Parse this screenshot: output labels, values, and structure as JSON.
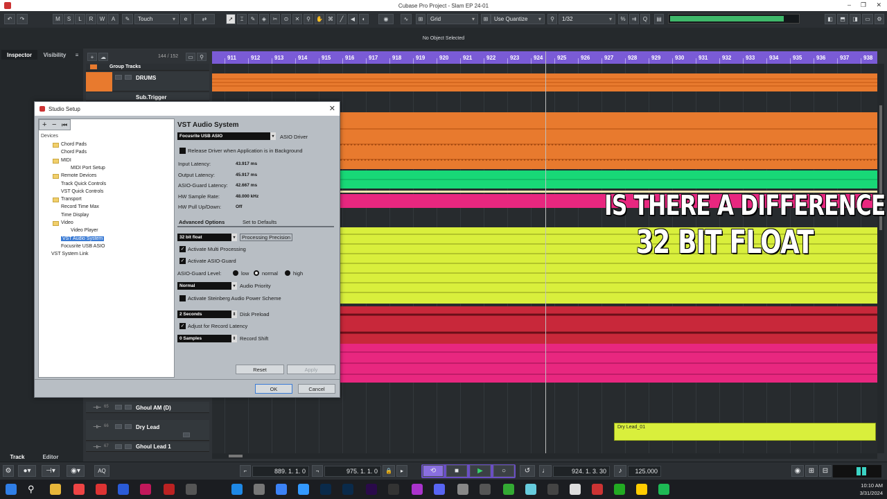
{
  "window": {
    "title": "Cubase Pro Project - Slam EP 24-01"
  },
  "toolbar": {
    "mode_buttons": [
      "M",
      "S",
      "L",
      "R",
      "W",
      "A"
    ],
    "automation_mode": "Touch",
    "snap_type": "Grid",
    "quantize_mode": "Use Quantize",
    "quantize_value": "1/32"
  },
  "info_line": {
    "text": "No Object Selected"
  },
  "left_zone": {
    "tab_inspector": "Inspector",
    "tab_visibility": "Visibility",
    "tab_track": "Track",
    "tab_editor": "Editor"
  },
  "track_list": {
    "count": "144 / 152",
    "group_label": "Group Tracks",
    "tracks": [
      {
        "name": "DRUMS",
        "num": ""
      },
      {
        "name": "Sub.Trigger",
        "num": "23"
      },
      {
        "name": "Ghoul AM (D)",
        "num": "65"
      },
      {
        "name": "Dry Lead",
        "num": "66"
      },
      {
        "name": "Ghoul Lead 1",
        "num": "67"
      }
    ]
  },
  "ruler": {
    "bars": [
      "911",
      "912",
      "913",
      "914",
      "915",
      "916",
      "917",
      "918",
      "919",
      "920",
      "921",
      "922",
      "923",
      "924",
      "925",
      "926",
      "927",
      "928",
      "929",
      "930",
      "931",
      "932",
      "933",
      "934",
      "935",
      "936",
      "937",
      "938"
    ]
  },
  "events": {
    "dry_lead_label": "Dry Lead_01"
  },
  "overlay": {
    "line1": "IS THERE A DIFFERENCE",
    "line2": "32 BIT FLOAT"
  },
  "dialog": {
    "title": "Studio Setup",
    "devices_label": "Devices",
    "tree": [
      {
        "label": "Chord Pads",
        "indent": 1,
        "folder": true
      },
      {
        "label": "Chord Pads",
        "indent": 1,
        "folder": false
      },
      {
        "label": "MIDI",
        "indent": 1,
        "folder": true
      },
      {
        "label": "MIDI Port Setup",
        "indent": 2,
        "folder": false
      },
      {
        "label": "Remote Devices",
        "indent": 1,
        "folder": true
      },
      {
        "label": "Track Quick Controls",
        "indent": 1,
        "folder": false
      },
      {
        "label": "VST Quick Controls",
        "indent": 1,
        "folder": false
      },
      {
        "label": "Transport",
        "indent": 1,
        "folder": true
      },
      {
        "label": "Record Time Max",
        "indent": 1,
        "folder": false
      },
      {
        "label": "Time Display",
        "indent": 1,
        "folder": false
      },
      {
        "label": "Video",
        "indent": 1,
        "folder": true
      },
      {
        "label": "Video Player",
        "indent": 2,
        "folder": false
      },
      {
        "label": "VST Audio System",
        "indent": 1,
        "folder": false,
        "selected": true
      },
      {
        "label": "Focusrite USB ASIO",
        "indent": 1,
        "folder": false
      },
      {
        "label": "VST System Link",
        "indent": 0,
        "folder": false
      }
    ],
    "panel_title": "VST Audio System",
    "asio_driver_value": "Focusrite USB ASIO",
    "asio_driver_label": "ASIO Driver",
    "release_driver_label": "Release Driver when Application is in Background",
    "info": [
      {
        "label": "Input Latency:",
        "value": "43.917 ms"
      },
      {
        "label": "Output Latency:",
        "value": "45.917 ms"
      },
      {
        "label": "ASIO-Guard Latency:",
        "value": "42.667 ms"
      },
      {
        "label": "HW Sample Rate:",
        "value": "48.000 kHz"
      },
      {
        "label": "HW Pull Up/Down:",
        "value": "Off"
      }
    ],
    "advanced_tab": "Advanced Options",
    "defaults_tab": "Set to Defaults",
    "precision_value": "32 bit float",
    "precision_label": "Processing Precision",
    "multi_processing_label": "Activate Multi Processing",
    "asio_guard_label": "Activate ASIO-Guard",
    "asio_guard_level_label": "ASIO-Guard Level:",
    "level_options": [
      "low",
      "normal",
      "high"
    ],
    "priority_value": "Normal",
    "priority_label": "Audio Priority",
    "power_scheme_label": "Activate Steinberg Audio Power Scheme",
    "disk_preload_value": "2 Seconds",
    "disk_preload_label": "Disk Preload",
    "adjust_latency_label": "Adjust for Record Latency",
    "record_shift_value": "0 Samples",
    "record_shift_label": "Record Shift",
    "reset_label": "Reset",
    "apply_label": "Apply",
    "ok_label": "OK",
    "cancel_label": "Cancel"
  },
  "transport": {
    "aq_label": "AQ",
    "left_locator": "889. 1. 1.   0",
    "right_locator": "975. 1. 1.   0",
    "position": "924. 1. 3. 30",
    "tempo": "125.000"
  },
  "taskbar": {
    "time": "10:10 AM",
    "date": "3/31/2024"
  },
  "colors": {
    "ruler": "#7a5bd6",
    "orange": "#e87a2e",
    "green": "#18d877",
    "pink": "#e8277f",
    "yellow": "#d9ef3c",
    "red": "#c8283a"
  }
}
